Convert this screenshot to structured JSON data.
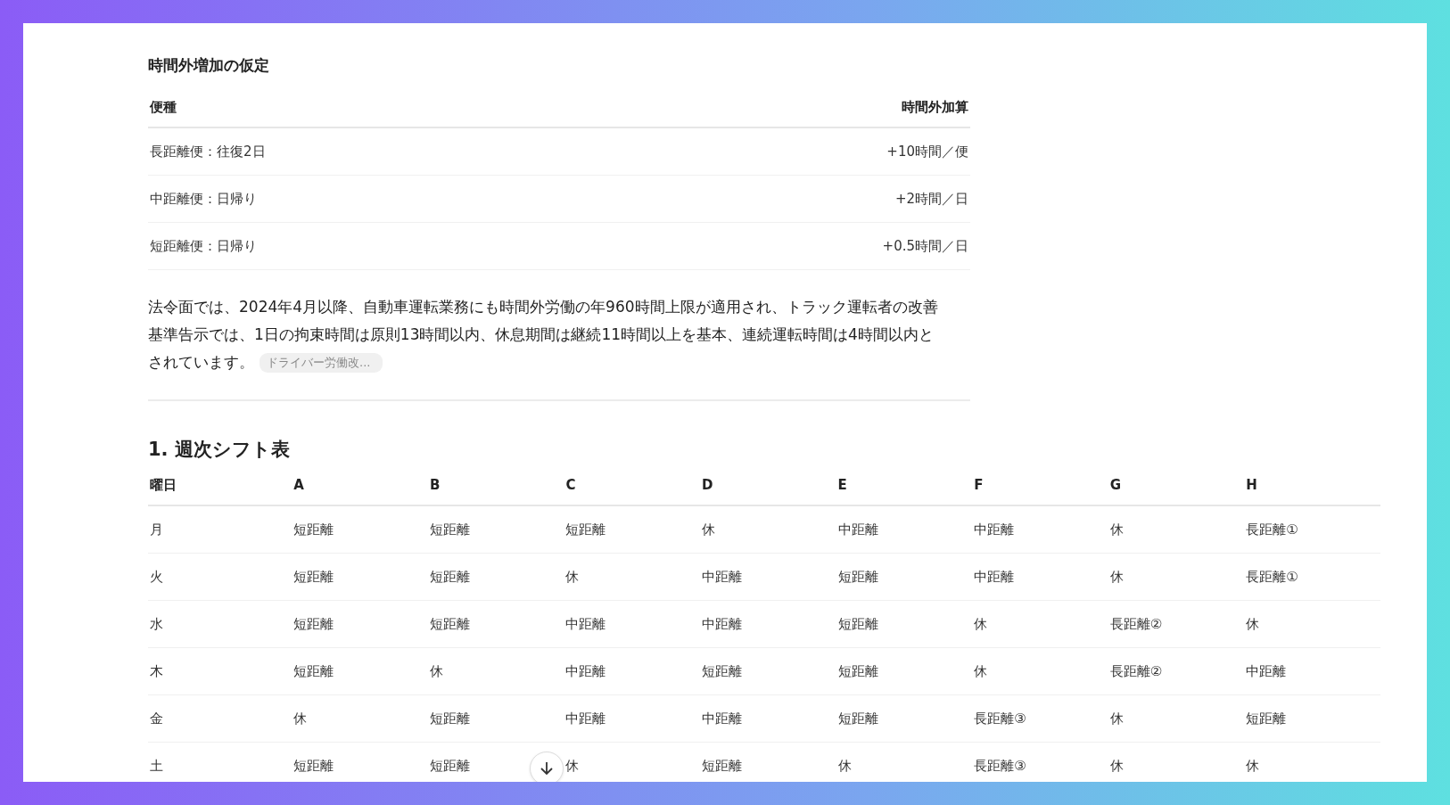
{
  "overtime_section": {
    "heading": "時間外増加の仮定",
    "columns": [
      "便種",
      "時間外加算"
    ],
    "rows": [
      [
        "長距離便：往復2日",
        "+10時間／便"
      ],
      [
        "中距離便：日帰り",
        "+2時間／日"
      ],
      [
        "短距離便：日帰り",
        "+0.5時間／日"
      ]
    ]
  },
  "paragraph": "法令面では、2024年4月以降、自動車運転業務にも時間外労働の年960時間上限が適用され、トラック運転者の改善基準告示では、1日の拘束時間は原則13時間以内、休息期間は継続11時間以上を基本、連続運転時間は4時間以内とされています。",
  "citation": "ドライバー労働改...",
  "shift_section": {
    "heading": "1. 週次シフト表",
    "columns": [
      "曜日",
      "A",
      "B",
      "C",
      "D",
      "E",
      "F",
      "G",
      "H"
    ],
    "rows": [
      [
        "月",
        "短距離",
        "短距離",
        "短距離",
        "休",
        "中距離",
        "中距離",
        "休",
        "長距離①"
      ],
      [
        "火",
        "短距離",
        "短距離",
        "休",
        "中距離",
        "短距離",
        "中距離",
        "休",
        "長距離①"
      ],
      [
        "水",
        "短距離",
        "短距離",
        "中距離",
        "中距離",
        "短距離",
        "休",
        "長距離②",
        "休"
      ],
      [
        "木",
        "短距離",
        "休",
        "中距離",
        "短距離",
        "短距離",
        "休",
        "長距離②",
        "中距離"
      ],
      [
        "金",
        "休",
        "短距離",
        "中距離",
        "中距離",
        "短距離",
        "長距離③",
        "休",
        "短距離"
      ],
      [
        "土",
        "短距離",
        "短距離",
        "休",
        "短距離",
        "休",
        "長距離③",
        "休",
        "休"
      ]
    ]
  },
  "scroll_button": {
    "kind": "down"
  }
}
